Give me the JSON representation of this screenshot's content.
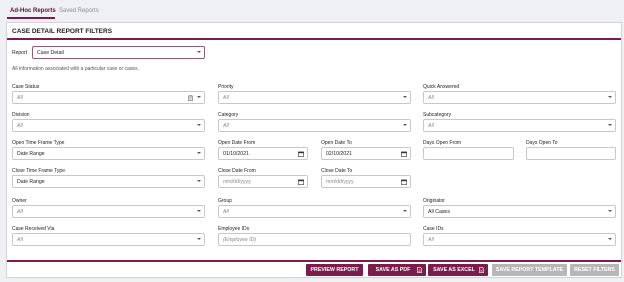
{
  "tabs": [
    {
      "label": "Ad-Hoc Reports"
    },
    {
      "label": "Saved Reports"
    }
  ],
  "card": {
    "title": "CASE DETAIL REPORT FILTERS"
  },
  "report": {
    "label": "Report",
    "value": "Case Detail",
    "description": "All information associated with a particular case or cases."
  },
  "filters": {
    "case_status": {
      "label": "Case Status",
      "value": "All"
    },
    "priority": {
      "label": "Priority",
      "value": "All"
    },
    "quick_answered": {
      "label": "Quick Answered",
      "value": "All"
    },
    "division": {
      "label": "Division",
      "value": "All"
    },
    "category": {
      "label": "Category",
      "value": "All"
    },
    "subcategory": {
      "label": "Subcategory",
      "value": "All"
    },
    "open_time_frame_type": {
      "label": "Open Time Frame Type",
      "value": "Date Range"
    },
    "open_date_from": {
      "label": "Open Date From",
      "value": "01/10/2021"
    },
    "open_date_to": {
      "label": "Open Date To",
      "value": "02/10/2021"
    },
    "days_open_from": {
      "label": "Days Open From",
      "value": ""
    },
    "days_open_to": {
      "label": "Days Open To",
      "value": ""
    },
    "close_time_frame_type": {
      "label": "Close Time Frame Type",
      "value": "Date Range"
    },
    "close_date_from": {
      "label": "Close Date From",
      "placeholder": "mm/dd/yyyy"
    },
    "close_date_to": {
      "label": "Close Date To",
      "placeholder": "mm/dd/yyyy"
    },
    "owner": {
      "label": "Owner",
      "value": "All"
    },
    "group": {
      "label": "Group",
      "value": "All"
    },
    "originator": {
      "label": "Originator",
      "value": "All Cases"
    },
    "case_received_via": {
      "label": "Case Received Via",
      "value": "All"
    },
    "employee_ids": {
      "label": "Employee IDs",
      "placeholder": "(Employee ID)"
    },
    "case_ids": {
      "label": "Case IDs",
      "value": "All"
    }
  },
  "actions": {
    "preview": "PREVIEW REPORT",
    "save_pdf": "SAVE AS PDF",
    "save_excel": "SAVE AS EXCEL",
    "save_template": "SAVE REPORT TEMPLATE",
    "reset": "RESET FILTERS"
  },
  "colors": {
    "accent": "#7a1d4d",
    "disabled": "#b7b7b7"
  }
}
